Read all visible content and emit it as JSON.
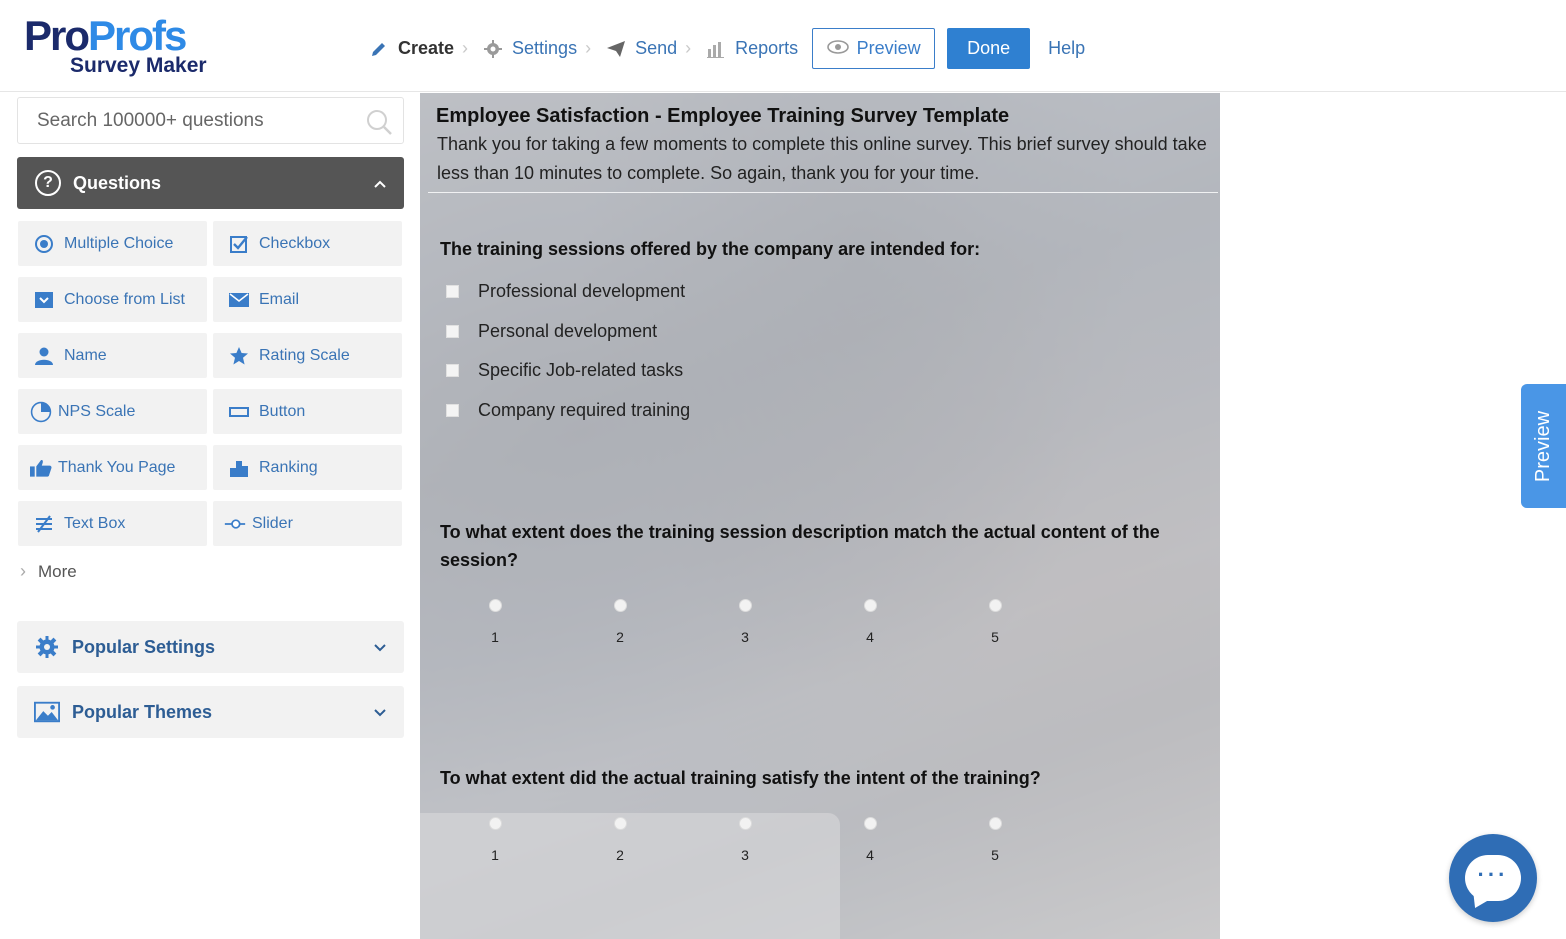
{
  "brand": {
    "name_part1": "Pro",
    "name_part2": "Profs",
    "subtitle": "Survey Maker"
  },
  "nav": {
    "create": "Create",
    "settings": "Settings",
    "send": "Send",
    "reports": "Reports",
    "preview": "Preview",
    "done": "Done",
    "help": "Help"
  },
  "sidebar": {
    "search_placeholder": "Search 100000+ questions",
    "questions_panel": "Questions",
    "question_types": [
      {
        "label": "Multiple Choice",
        "icon": "radio-icon"
      },
      {
        "label": "Checkbox",
        "icon": "checkbox-icon"
      },
      {
        "label": "Choose from List",
        "icon": "dropdown-icon"
      },
      {
        "label": "Email",
        "icon": "email-icon"
      },
      {
        "label": "Name",
        "icon": "person-icon"
      },
      {
        "label": "Rating Scale",
        "icon": "star-icon"
      },
      {
        "label": "NPS Scale",
        "icon": "nps-icon"
      },
      {
        "label": "Button",
        "icon": "button-icon"
      },
      {
        "label": "Thank You Page",
        "icon": "thumbs-up-icon"
      },
      {
        "label": "Ranking",
        "icon": "ranking-icon"
      },
      {
        "label": "Text Box",
        "icon": "text-box-icon"
      },
      {
        "label": "Slider",
        "icon": "slider-icon"
      }
    ],
    "more": "More",
    "popular_settings": "Popular Settings",
    "popular_themes": "Popular Themes"
  },
  "survey": {
    "title": "Employee Satisfaction - Employee Training Survey Template",
    "description": "Thank you for taking a few moments to complete this online survey.  This brief survey should take less than 10 minutes to complete.  So again, thank you for your time.",
    "q1": {
      "text": "The training sessions offered by the company are intended for:",
      "options": [
        "Professional development",
        "Personal development",
        "Specific Job-related tasks",
        "Company required training"
      ]
    },
    "q2": {
      "text": "To what extent does the training session description match the actual content of the session?",
      "scale": [
        "1",
        "2",
        "3",
        "4",
        "5"
      ]
    },
    "q3": {
      "text": "To what extent did the actual training satisfy the intent of the training?",
      "scale": [
        "1",
        "2",
        "3",
        "4",
        "5"
      ]
    }
  },
  "preview_tab": "Preview",
  "colors": {
    "accent": "#2f80d1",
    "link": "#3a74b5",
    "brand_dark": "#1b2a6b",
    "brand_light": "#2e8ae6",
    "panel_dark": "#555555"
  }
}
